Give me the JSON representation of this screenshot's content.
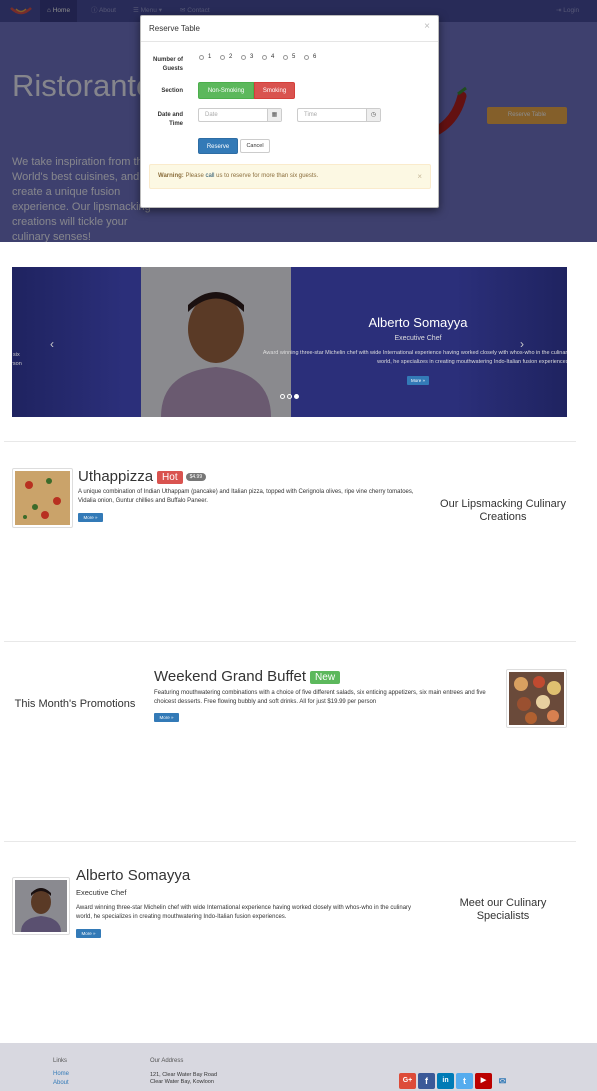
{
  "nav": {
    "home": "Home",
    "about": "About",
    "menu": "Menu",
    "contact": "Contact",
    "login": "Login"
  },
  "hero": {
    "title": "Ristorante",
    "text": "We take inspiration from the World's best cuisines, and create a unique fusion experience. Our lipsmacking creations will tickle your culinary senses!",
    "reserve_button": "Reserve Table"
  },
  "modal": {
    "title": "Reserve Table",
    "close": "×",
    "guests_label": "Number of Guests",
    "guests_options": [
      "1",
      "2",
      "3",
      "4",
      "5",
      "6"
    ],
    "section_label": "Section",
    "section_nonsmoking": "Non-Smoking",
    "section_smoking": "Smoking",
    "datetime_label": "Date and Time",
    "date_placeholder": "Date",
    "time_placeholder": "Time",
    "reserve_button": "Reserve",
    "cancel_button": "Cancel",
    "alert_strong": "Warning:",
    "alert_pre": "Please",
    "alert_link": "call",
    "alert_post": "us to reserve for more than six guests."
  },
  "carousel": {
    "title": "Alberto Somayya",
    "subtitle": "Executive Chef",
    "text": "Award winning three-star Michelin chef with wide International experience having worked closely with whos-who in the culinary world, he specializes in creating mouthwatering Indo-Italian fusion experiences.",
    "more": "More »",
    "left_fragment_1": "six",
    "left_fragment_2": "erson",
    "prev_icon": "‹",
    "next_icon": "›"
  },
  "dish": {
    "name": "Uthappizza",
    "label": "Hot",
    "price": "$4.99",
    "description": "A unique combination of Indian Uthappam (pancake) and Italian pizza, topped with Cerignola olives, ripe vine cherry tomatoes, Vidalia onion, Guntur chillies and Buffalo Paneer.",
    "more": "More »",
    "side_heading": "Our Lipsmacking Culinary Creations"
  },
  "promo": {
    "name": "Weekend Grand Buffet",
    "label": "New",
    "description": "Featuring mouthwatering combinations with a choice of five different salads, six enticing appetizers, six main entrees and five choicest desserts. Free flowing bubbly and soft drinks. All for just $19.99 per person",
    "more": "More »",
    "side_heading": "This Month's Promotions"
  },
  "leader": {
    "name": "Alberto Somayya",
    "designation": "Executive Chef",
    "description": "Award winning three-star Michelin chef with wide International experience having worked closely with whos-who in the culinary world, he specializes in creating mouthwatering Indo-Italian fusion experiences.",
    "more": "More »",
    "side_heading": "Meet our Culinary Specialists"
  },
  "footer": {
    "links_heading": "Links",
    "links": [
      "Home",
      "About"
    ],
    "address_heading": "Our Address",
    "address_line1": "121, Clear Water Bay Road",
    "address_line2": "Clear Water Bay, Kowloon",
    "social": [
      "G+",
      "f",
      "in",
      "t",
      "▶",
      "✉"
    ]
  },
  "colors": {
    "navbar": "#4a4fa0",
    "hero": "#7276c9",
    "accent": "#f0ad4e",
    "primary": "#337ab7"
  }
}
